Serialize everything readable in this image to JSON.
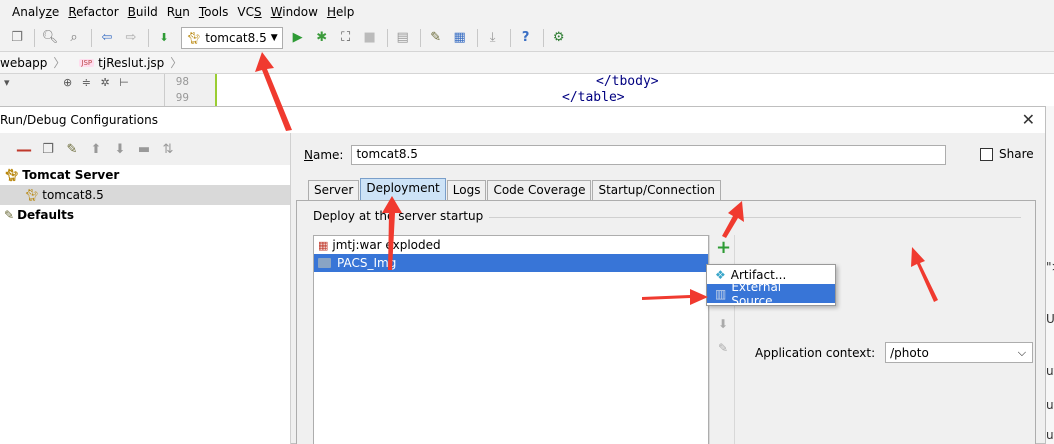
{
  "menu": [
    {
      "pre": "Analy",
      "u": "z",
      "post": "e"
    },
    {
      "pre": "",
      "u": "R",
      "post": "efactor"
    },
    {
      "pre": "",
      "u": "B",
      "post": "uild"
    },
    {
      "pre": "R",
      "u": "u",
      "post": "n"
    },
    {
      "pre": "",
      "u": "T",
      "post": "ools"
    },
    {
      "pre": "VC",
      "u": "S",
      "post": ""
    },
    {
      "pre": "",
      "u": "W",
      "post": "indow"
    },
    {
      "pre": "",
      "u": "H",
      "post": "elp"
    }
  ],
  "toolbar": {
    "run_config": "tomcat8.5"
  },
  "breadcrumbs": {
    "item1": "webapp",
    "item2_icon_text": "JSP",
    "item2": "tjReslut.jsp"
  },
  "editor": {
    "line_numbers": [
      "98",
      "99"
    ],
    "code_line1": "</tbody>",
    "code_line2": "</table>"
  },
  "dialog": {
    "title": "Run/Debug Configurations",
    "tree": {
      "group1": "Tomcat Server",
      "child1": "tomcat8.5",
      "group2": "Defaults"
    },
    "name_label_pre": "",
    "name_label_u": "N",
    "name_label_post": "ame:",
    "name_value": "tomcat8.5",
    "share_label": "Share",
    "tabs": [
      "Server",
      "Deployment",
      "Logs",
      "Code Coverage",
      "Startup/Connection"
    ],
    "active_tab": "Deployment",
    "group_title": "Deploy at the server startup",
    "deploy_items": [
      {
        "label": "jmtj:war exploded",
        "selected": false
      },
      {
        "label": "PACS_Img",
        "selected": true
      }
    ],
    "popup_items": [
      {
        "label": "Artifact...",
        "selected": false
      },
      {
        "label": "External Source...",
        "selected": true
      }
    ],
    "app_context_label": "Application context:",
    "app_context_value": "/photo"
  },
  "right_fragments": [
    "\">",
    "Ur",
    "ut",
    "ut",
    "ut"
  ],
  "colors": {
    "selection": "#3875d7",
    "active_tab": "#cde3f7",
    "plus_green": "#2e9b35",
    "annotation_red": "#f03a2f"
  }
}
